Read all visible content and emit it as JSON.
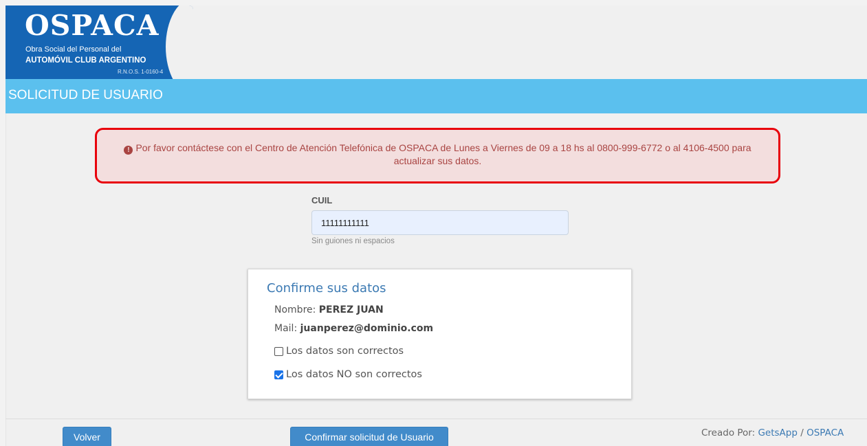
{
  "logo": {
    "title": "OSPACA",
    "subtitle_line1": "Obra Social del Personal del",
    "subtitle_line2": "AUTOMÓVIL CLUB ARGENTINO",
    "registry": "R.N.O.S. 1-0160-4"
  },
  "header": {
    "title": "SOLICITUD DE USUARIO"
  },
  "alert": {
    "icon": "exclamation-circle-icon",
    "message": "Por favor contáctese con el Centro de Atención Telefónica de OSPACA de Lunes a Viernes de 09 a 18 hs al 0800-999-6772 o al 4106-4500 para actualizar sus datos.",
    "border_color": "#e8000b",
    "text_color": "#a94442"
  },
  "form": {
    "cuil_label": "CUIL",
    "cuil_value": "11111111111",
    "cuil_help": "Sin guiones ni espacios"
  },
  "confirm": {
    "title": "Confirme sus datos",
    "name_label": "Nombre:",
    "name_value": "PEREZ JUAN",
    "mail_label": "Mail:",
    "mail_value": "juanperez@dominio.com",
    "option_correct": "Los datos son correctos",
    "option_correct_checked": false,
    "option_incorrect": "Los datos NO son correctos",
    "option_incorrect_checked": true
  },
  "footer": {
    "back_button": "Volver",
    "confirm_button": "Confirmar solicitud de Usuario",
    "credits_prefix": "Creado Por:",
    "credits_link1": "GetsApp",
    "credits_separator": "/",
    "credits_link2": "OSPACA"
  },
  "colors": {
    "brand_blue": "#1565b4",
    "title_bar": "#5bc0ee",
    "button": "#428bca"
  }
}
